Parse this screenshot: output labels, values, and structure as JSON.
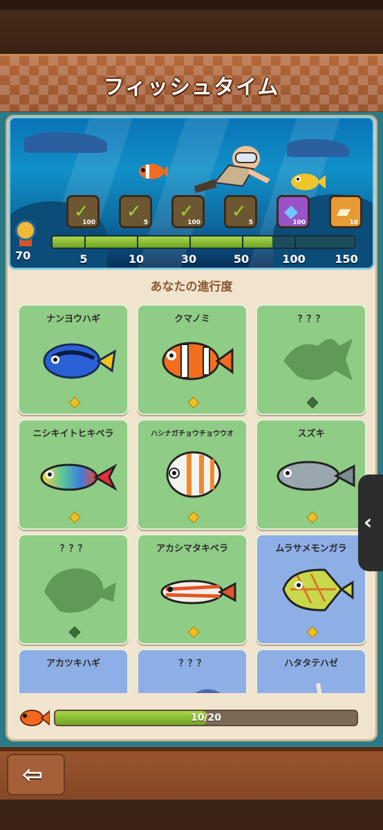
{
  "header": {
    "title": "フィッシュタイム"
  },
  "banner": {
    "medal_value": "70",
    "progress_percent": 0.73,
    "milestones": [
      {
        "label": "5",
        "reward_count": "100",
        "done": true,
        "color": "#6d5732"
      },
      {
        "label": "10",
        "reward_count": "5",
        "done": true,
        "color": "#6d5732"
      },
      {
        "label": "30",
        "reward_count": "100",
        "done": true,
        "color": "#6d5732"
      },
      {
        "label": "50",
        "reward_count": "5",
        "done": true,
        "color": "#6d5732"
      },
      {
        "label": "100",
        "reward_count": "100",
        "done": false,
        "color": "#9a52c9"
      },
      {
        "label": "150",
        "reward_count": "10",
        "done": false,
        "color": "#e79a36"
      }
    ]
  },
  "progress": {
    "title": "あなたの進行度"
  },
  "fish_cards": [
    {
      "name": "ナンヨウハギ",
      "bg": "green",
      "fish": "blue-tang",
      "discovered": true
    },
    {
      "name": "クマノミ",
      "bg": "green",
      "fish": "clownfish",
      "discovered": true
    },
    {
      "name": "？？？",
      "bg": "green",
      "fish": "unknown",
      "discovered": false
    },
    {
      "name": "ニシキイトヒキベラ",
      "bg": "green",
      "fish": "rainbow-wrasse",
      "discovered": true
    },
    {
      "name": "ハシナガチョウチョウウオ",
      "bg": "green",
      "fish": "butterflyfish",
      "discovered": true
    },
    {
      "name": "スズキ",
      "bg": "green",
      "fish": "sea-bass",
      "discovered": true
    },
    {
      "name": "？？？",
      "bg": "green",
      "fish": "unknown",
      "discovered": false
    },
    {
      "name": "アカシマタキベラ",
      "bg": "green",
      "fish": "red-striped-wrasse",
      "discovered": true
    },
    {
      "name": "ムラサメモンガラ",
      "bg": "blue",
      "fish": "boxfish",
      "discovered": true
    },
    {
      "name": "アカツキハギ",
      "bg": "blue",
      "fish": "unknown-partial",
      "discovered": true
    },
    {
      "name": "？？？",
      "bg": "blue",
      "fish": "unknown",
      "discovered": false
    },
    {
      "name": "ハタタテハゼ",
      "bg": "green",
      "fish": "firefish",
      "discovered": true
    }
  ],
  "collection": {
    "text": "10/20",
    "fraction": 0.5
  },
  "buttons": {
    "back": "back-arrow-icon",
    "side_handle": "chevron-left-icon"
  }
}
